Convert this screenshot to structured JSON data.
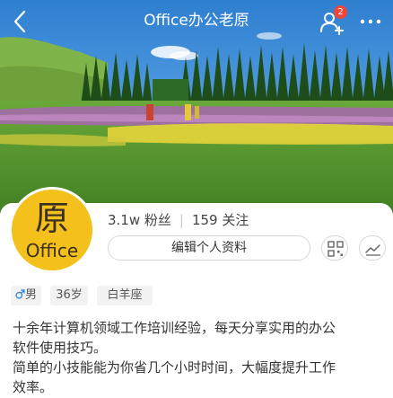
{
  "header": {
    "title": "Office办公老原",
    "notification_count": "2"
  },
  "profile": {
    "avatar_char": "原",
    "avatar_word": "Office",
    "followers": "3.1w 粉丝",
    "following": "159 关注",
    "edit_label": "编辑个人资料",
    "tags": {
      "gender": "男",
      "age": "36岁",
      "zodiac": "白羊座"
    },
    "bio_lines": [
      "十余年计算机领域工作培训经验，每天分享实用的办公",
      "软件使用技巧。",
      "简单的小技能能为你省几个小时时间，大幅度提升工作",
      "效率。"
    ]
  },
  "colors": {
    "accent_blue": "#3a8bd8",
    "avatar_yellow": "#f4c01b",
    "badge_red": "#f2453a"
  },
  "icons": [
    "back-icon",
    "follow-user-icon",
    "more-icon",
    "qr-code-icon",
    "trend-chart-icon",
    "male-icon"
  ]
}
